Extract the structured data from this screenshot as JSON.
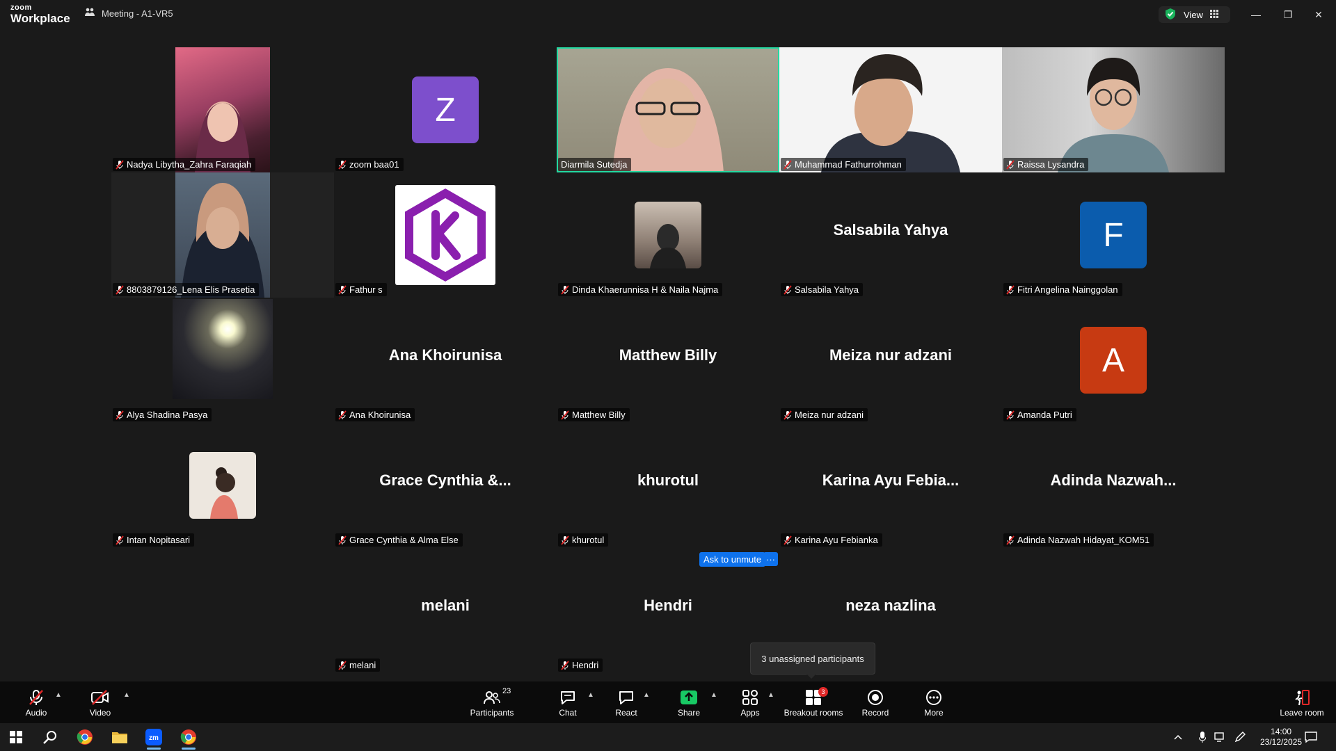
{
  "app": {
    "logo_line1": "zoom",
    "logo_line2": "Workplace",
    "meeting_title": "Meeting - A1-VR5",
    "view_label": "View"
  },
  "window": {
    "minimize": "—",
    "restore": "❐",
    "close": "✕"
  },
  "tiles": [
    {
      "id": "nadya",
      "name": "Nadya Libytha_Zahra Faraqiah",
      "center": ""
    },
    {
      "id": "zoombaa",
      "name": "zoom baa01",
      "center": "",
      "avatar_letter": "Z",
      "avatar_color": "#7d4fcc"
    },
    {
      "id": "diarmila",
      "name": "Diarmila Sutedja",
      "center": ""
    },
    {
      "id": "muhammad",
      "name": "Muhammad Fathurrohman",
      "center": ""
    },
    {
      "id": "raissa",
      "name": "Raissa Lysandra",
      "center": ""
    },
    {
      "id": "lena",
      "name": "8803879126_Lena Elis Prasetia",
      "center": ""
    },
    {
      "id": "fathur",
      "name": "Fathur s",
      "center": ""
    },
    {
      "id": "dinda",
      "name": "Dinda Khaerunnisa H & Naila Najma",
      "center": ""
    },
    {
      "id": "salsabila",
      "name": "Salsabila Yahya",
      "center": "Salsabila Yahya"
    },
    {
      "id": "fitri",
      "name": "Fitri Angelina Nainggolan",
      "center": "",
      "avatar_letter": "F",
      "avatar_color": "#0b5cad"
    },
    {
      "id": "alya",
      "name": "Alya Shadina Pasya",
      "center": ""
    },
    {
      "id": "ana",
      "name": "Ana Khoirunisa",
      "center": "Ana Khoirunisa"
    },
    {
      "id": "matthew",
      "name": "Matthew Billy",
      "center": "Matthew Billy"
    },
    {
      "id": "meiza",
      "name": "Meiza nur adzani",
      "center": "Meiza nur adzani"
    },
    {
      "id": "amanda",
      "name": "Amanda Putri",
      "center": "",
      "avatar_letter": "A",
      "avatar_color": "#c73a12"
    },
    {
      "id": "intan",
      "name": "Intan Nopitasari",
      "center": ""
    },
    {
      "id": "grace",
      "name": "Grace Cynthia & Alma Else",
      "center": "Grace Cynthia &..."
    },
    {
      "id": "khurotul",
      "name": "khurotul",
      "center": "khurotul"
    },
    {
      "id": "karina",
      "name": "Karina Ayu Febianka",
      "center": "Karina Ayu Febia..."
    },
    {
      "id": "adinda",
      "name": "Adinda Nazwah Hidayat_KOM51",
      "center": "Adinda Nazwah..."
    },
    {
      "id": "melani",
      "name": "melani",
      "center": "melani"
    },
    {
      "id": "hendri",
      "name": "Hendri",
      "center": "Hendri"
    },
    {
      "id": "neza",
      "name": "",
      "center": "neza nazlina"
    }
  ],
  "overlay": {
    "ask_to_unmute": "Ask to unmute",
    "more": "···",
    "tooltip": "3 unassigned participants"
  },
  "toolbar": {
    "audio": "Audio",
    "video": "Video",
    "participants": "Participants",
    "participants_count": "23",
    "chat": "Chat",
    "react": "React",
    "share": "Share",
    "apps": "Apps",
    "breakout": "Breakout rooms",
    "breakout_badge": "3",
    "record": "Record",
    "more": "More",
    "leave": "Leave room"
  },
  "taskbar": {
    "time": "14:00",
    "date": "23/12/2025"
  },
  "colors": {
    "active_speaker": "#23d9a1",
    "share_green": "#18c964",
    "accent_blue": "#0e72ed"
  }
}
